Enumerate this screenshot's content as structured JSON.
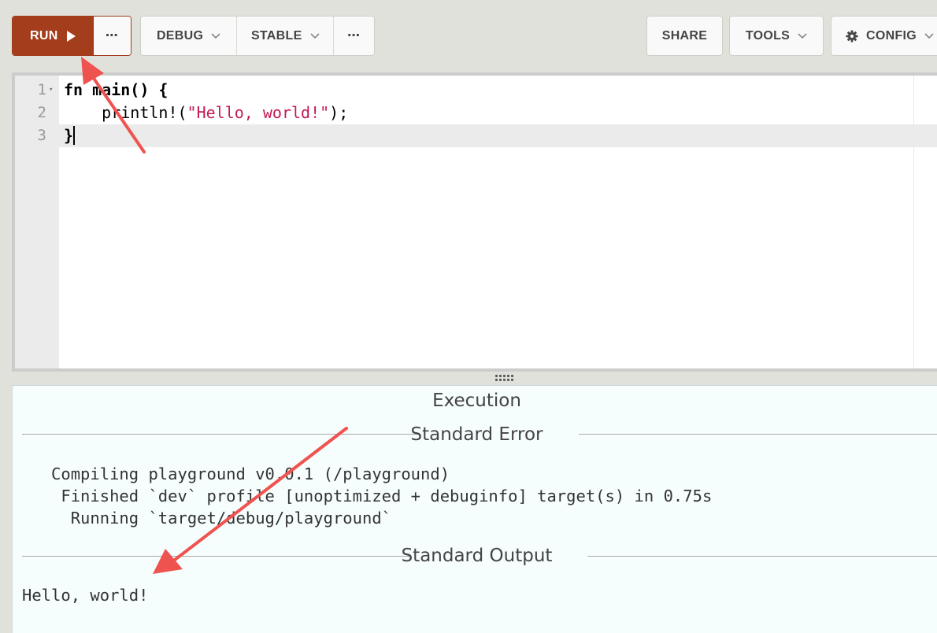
{
  "toolbar": {
    "run_label": "RUN",
    "more_label": "⋯",
    "debug_label": "DEBUG",
    "stable_label": "STABLE",
    "share_label": "SHARE",
    "tools_label": "TOOLS",
    "config_label": "CONFIG"
  },
  "editor": {
    "lines": [
      {
        "num": "1",
        "code_kw": "fn",
        "code_rest": " main() {"
      },
      {
        "num": "2",
        "code_prefix": "    println!(",
        "code_str": "\"Hello, world!\"",
        "code_suffix": ");"
      },
      {
        "num": "3",
        "code": "}"
      }
    ]
  },
  "output": {
    "execution_title": "Execution",
    "stderr_title": "Standard Error",
    "stderr_lines": [
      "   Compiling playground v0.0.1 (/playground)",
      "    Finished `dev` profile [unoptimized + debuginfo] target(s) in 0.75s",
      "     Running `target/debug/playground`"
    ],
    "stdout_title": "Standard Output",
    "stdout_text": "Hello, world!"
  },
  "colors": {
    "run_button": "#a43d1c",
    "annotation_arrow": "#ef5350",
    "string_literal": "#c41a52",
    "output_background": "#f6fdfd"
  }
}
